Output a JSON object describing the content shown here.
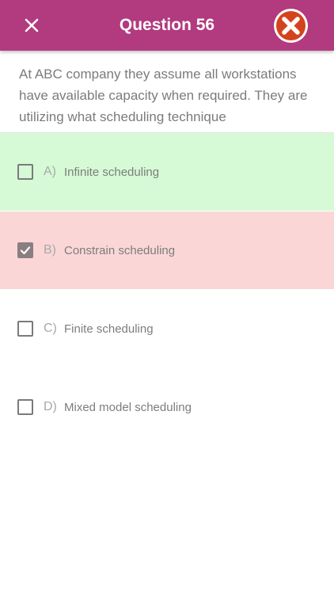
{
  "header": {
    "title": "Question 56",
    "bg_color": "#b23a7f",
    "close_icon": "close-icon",
    "status_icon": "wrong-answer-icon"
  },
  "question": {
    "text": "At ABC company they assume all workstations have available capacity when required. They are utilizing what scheduling technique"
  },
  "options": [
    {
      "letter": "A)",
      "text": "Infinite scheduling",
      "checked": false,
      "state": "correct",
      "bg": "#d5fad5"
    },
    {
      "letter": "B)",
      "text": "Constrain scheduling",
      "checked": true,
      "state": "wrong",
      "bg": "#fbd6d6"
    },
    {
      "letter": "C)",
      "text": "Finite scheduling",
      "checked": false,
      "state": "neutral",
      "bg": "#ffffff"
    },
    {
      "letter": "D)",
      "text": "Mixed model scheduling",
      "checked": false,
      "state": "neutral",
      "bg": "#ffffff"
    }
  ]
}
